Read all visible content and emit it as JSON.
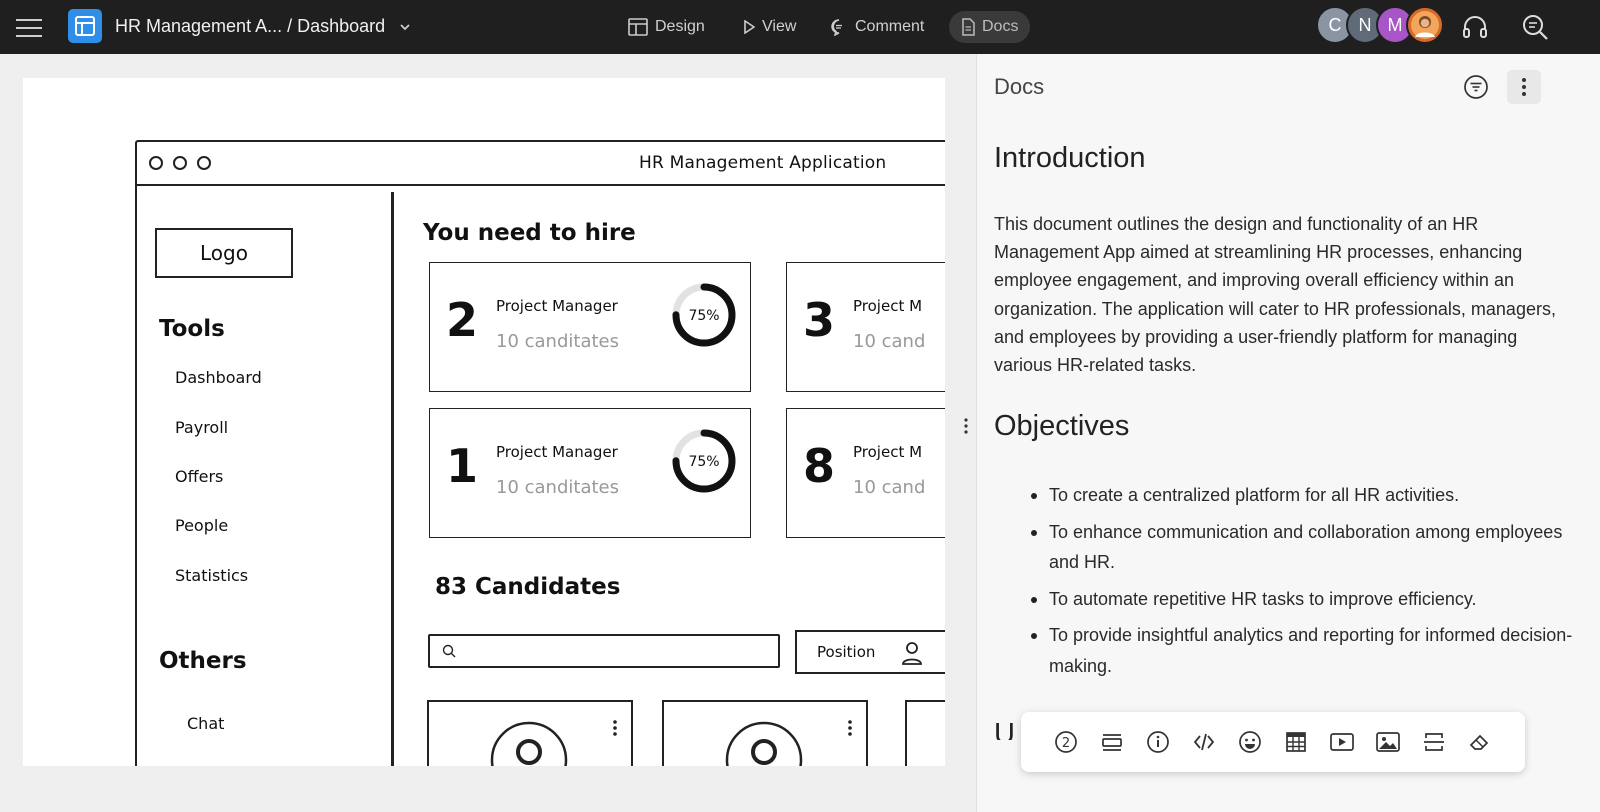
{
  "topbar": {
    "breadcrumb": "HR Management A... / Dashboard",
    "tools": [
      {
        "label": "Design"
      },
      {
        "label": "View"
      },
      {
        "label": "Comment"
      },
      {
        "label": "Docs"
      }
    ],
    "avatars": [
      {
        "initial": "C",
        "color": "#8a95a3"
      },
      {
        "initial": "N",
        "color": "#5f6b78"
      },
      {
        "initial": "M",
        "color": "#a855c7"
      },
      {
        "initial": "",
        "color": "#d9692b"
      }
    ]
  },
  "wireframe": {
    "window_title": "HR Management Application",
    "logo": "Logo",
    "tools_heading": "Tools",
    "tools": [
      "Dashboard",
      "Payroll",
      "Offers",
      "People",
      "Statistics"
    ],
    "others_heading": "Others",
    "others": [
      "Chat"
    ],
    "hire_title": "You need to hire",
    "cards": [
      {
        "num": "2",
        "role": "Project Manager",
        "count": "10 canditates",
        "pct": "75%",
        "progress": 0.75
      },
      {
        "num": "3",
        "role": "Project M",
        "count": "10 cand"
      },
      {
        "num": "1",
        "role": "Project Manager",
        "count": "10 canditates",
        "pct": "75%",
        "progress": 0.75
      },
      {
        "num": "8",
        "role": "Project M",
        "count": "10 cand"
      }
    ],
    "candidates_title": "83 Candidates",
    "position_filter": "Position"
  },
  "docs": {
    "panel_title": "Docs",
    "intro_heading": "Introduction",
    "intro_text": "This document outlines the design and functionality of an HR Management App aimed at streamlining HR processes, enhancing employee engagement, and improving overall efficiency within an organization. The application will cater to HR professionals, managers, and employees by providing a user-friendly platform for managing various HR-related tasks.",
    "objectives_heading": "Objectives",
    "objectives": [
      "To create a centralized platform for all HR activities.",
      "To enhance communication and collaboration among employees and HR.",
      "To automate repetitive HR tasks to improve efficiency.",
      "To provide insightful analytics and reporting for informed decision-making."
    ],
    "next_heading_fragment": "U",
    "toolbar_icons": [
      "placeholder-icon",
      "card-icon",
      "info-icon",
      "code-icon",
      "emoji-icon",
      "table-icon",
      "video-icon",
      "image-icon",
      "divider-icon",
      "eraser-icon"
    ]
  }
}
